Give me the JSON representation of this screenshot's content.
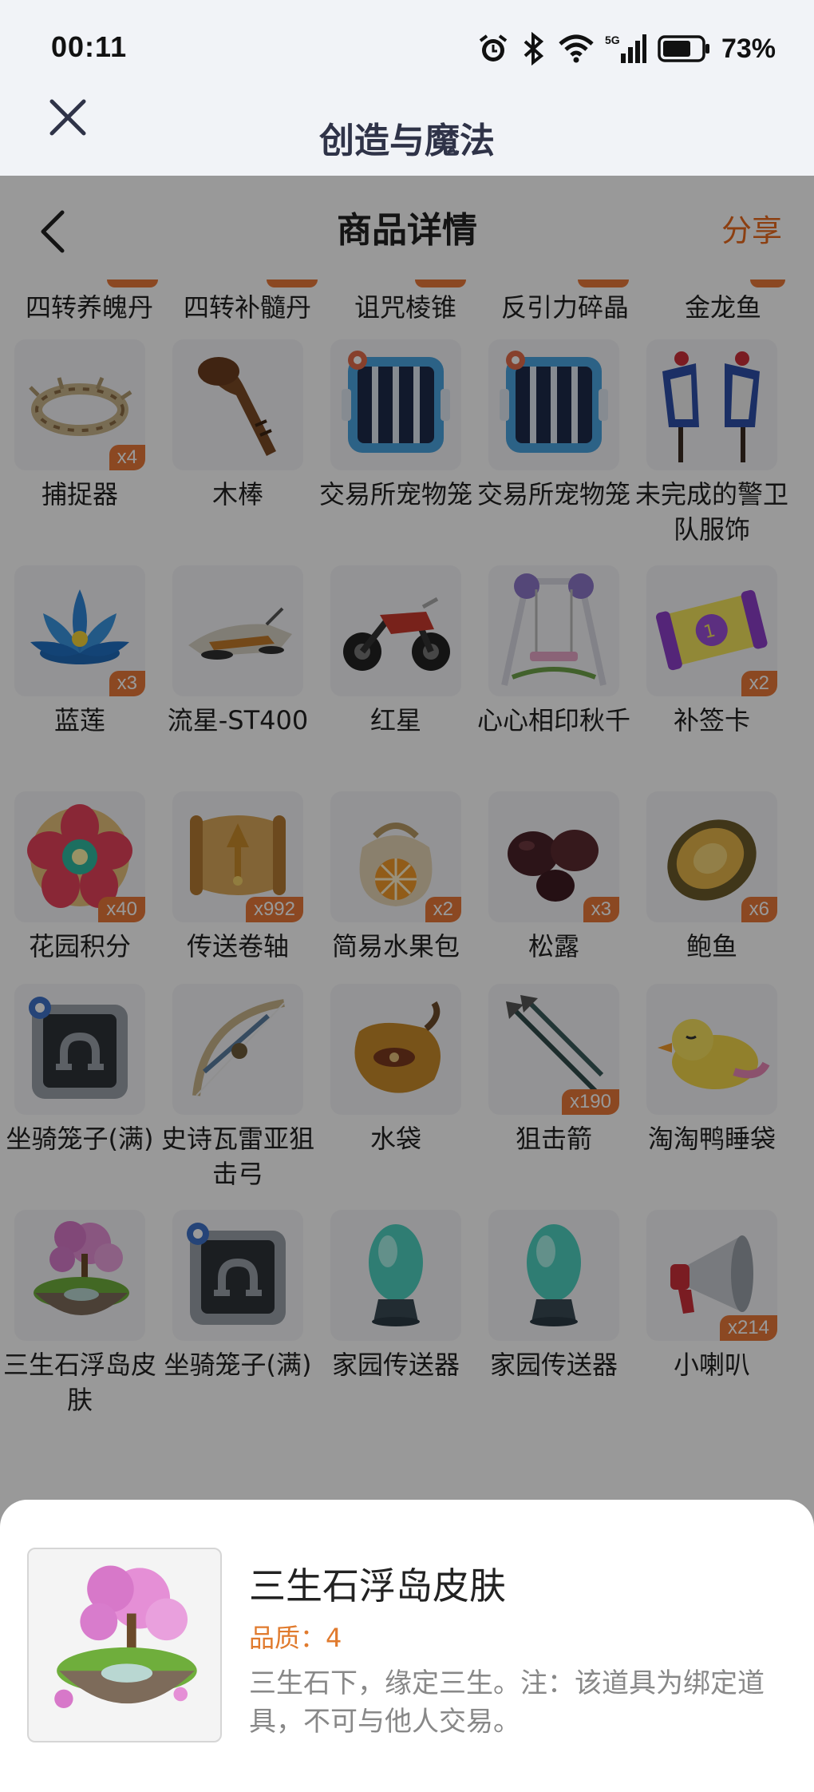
{
  "status_bar": {
    "time": "00:11",
    "battery": "73%"
  },
  "app_bar": {
    "title": "创造与魔法"
  },
  "nav": {
    "title": "商品详情",
    "share": "分享"
  },
  "partial_row": [
    "四转养魄丹",
    "四转补髓丹",
    "诅咒棱锥",
    "反引力碎晶",
    "金龙鱼"
  ],
  "items": [
    {
      "name": "捕捉器",
      "qty": "x4",
      "icon": "thorn-ring"
    },
    {
      "name": "木棒",
      "qty": "",
      "icon": "wooden-club"
    },
    {
      "name": "交易所宠物笼",
      "qty": "",
      "icon": "pet-cage"
    },
    {
      "name": "交易所宠物笼",
      "qty": "",
      "icon": "pet-cage"
    },
    {
      "name": "未完成的警卫队服饰",
      "qty": "",
      "icon": "guard-outfit"
    },
    {
      "name": "蓝莲",
      "qty": "x3",
      "icon": "blue-lotus"
    },
    {
      "name": "流星-ST400",
      "qty": "",
      "icon": "hover-bike"
    },
    {
      "name": "红星",
      "qty": "",
      "icon": "motorcycle"
    },
    {
      "name": "心心相印秋千",
      "qty": "",
      "icon": "swing"
    },
    {
      "name": "补签卡",
      "qty": "x2",
      "icon": "purple-card"
    },
    {
      "name": "花园积分",
      "qty": "x40",
      "icon": "flower-badge"
    },
    {
      "name": "传送卷轴",
      "qty": "x992",
      "icon": "scroll"
    },
    {
      "name": "简易水果包",
      "qty": "x2",
      "icon": "fruit-bag"
    },
    {
      "name": "松露",
      "qty": "x3",
      "icon": "truffle"
    },
    {
      "name": "鲍鱼",
      "qty": "x6",
      "icon": "abalone"
    },
    {
      "name": "坐骑笼子(满)",
      "qty": "",
      "icon": "mount-cage"
    },
    {
      "name": "史诗瓦雷亚狙击弓",
      "qty": "",
      "icon": "bow"
    },
    {
      "name": "水袋",
      "qty": "",
      "icon": "water-bag"
    },
    {
      "name": "狙击箭",
      "qty": "x190",
      "icon": "arrows"
    },
    {
      "name": "淘淘鸭睡袋",
      "qty": "",
      "icon": "duck-sleeping-bag"
    },
    {
      "name": "三生石浮岛皮肤",
      "qty": "",
      "icon": "floating-island"
    },
    {
      "name": "坐骑笼子(满)",
      "qty": "",
      "icon": "mount-cage"
    },
    {
      "name": "家园传送器",
      "qty": "",
      "icon": "teleporter"
    },
    {
      "name": "家园传送器",
      "qty": "",
      "icon": "teleporter"
    },
    {
      "name": "小喇叭",
      "qty": "x214",
      "icon": "megaphone"
    }
  ],
  "detail": {
    "name": "三生石浮岛皮肤",
    "quality": "品质：4",
    "description": "三生石下，缘定三生。注：该道具为绑定道具，不可与他人交易。",
    "icon": "floating-island"
  }
}
